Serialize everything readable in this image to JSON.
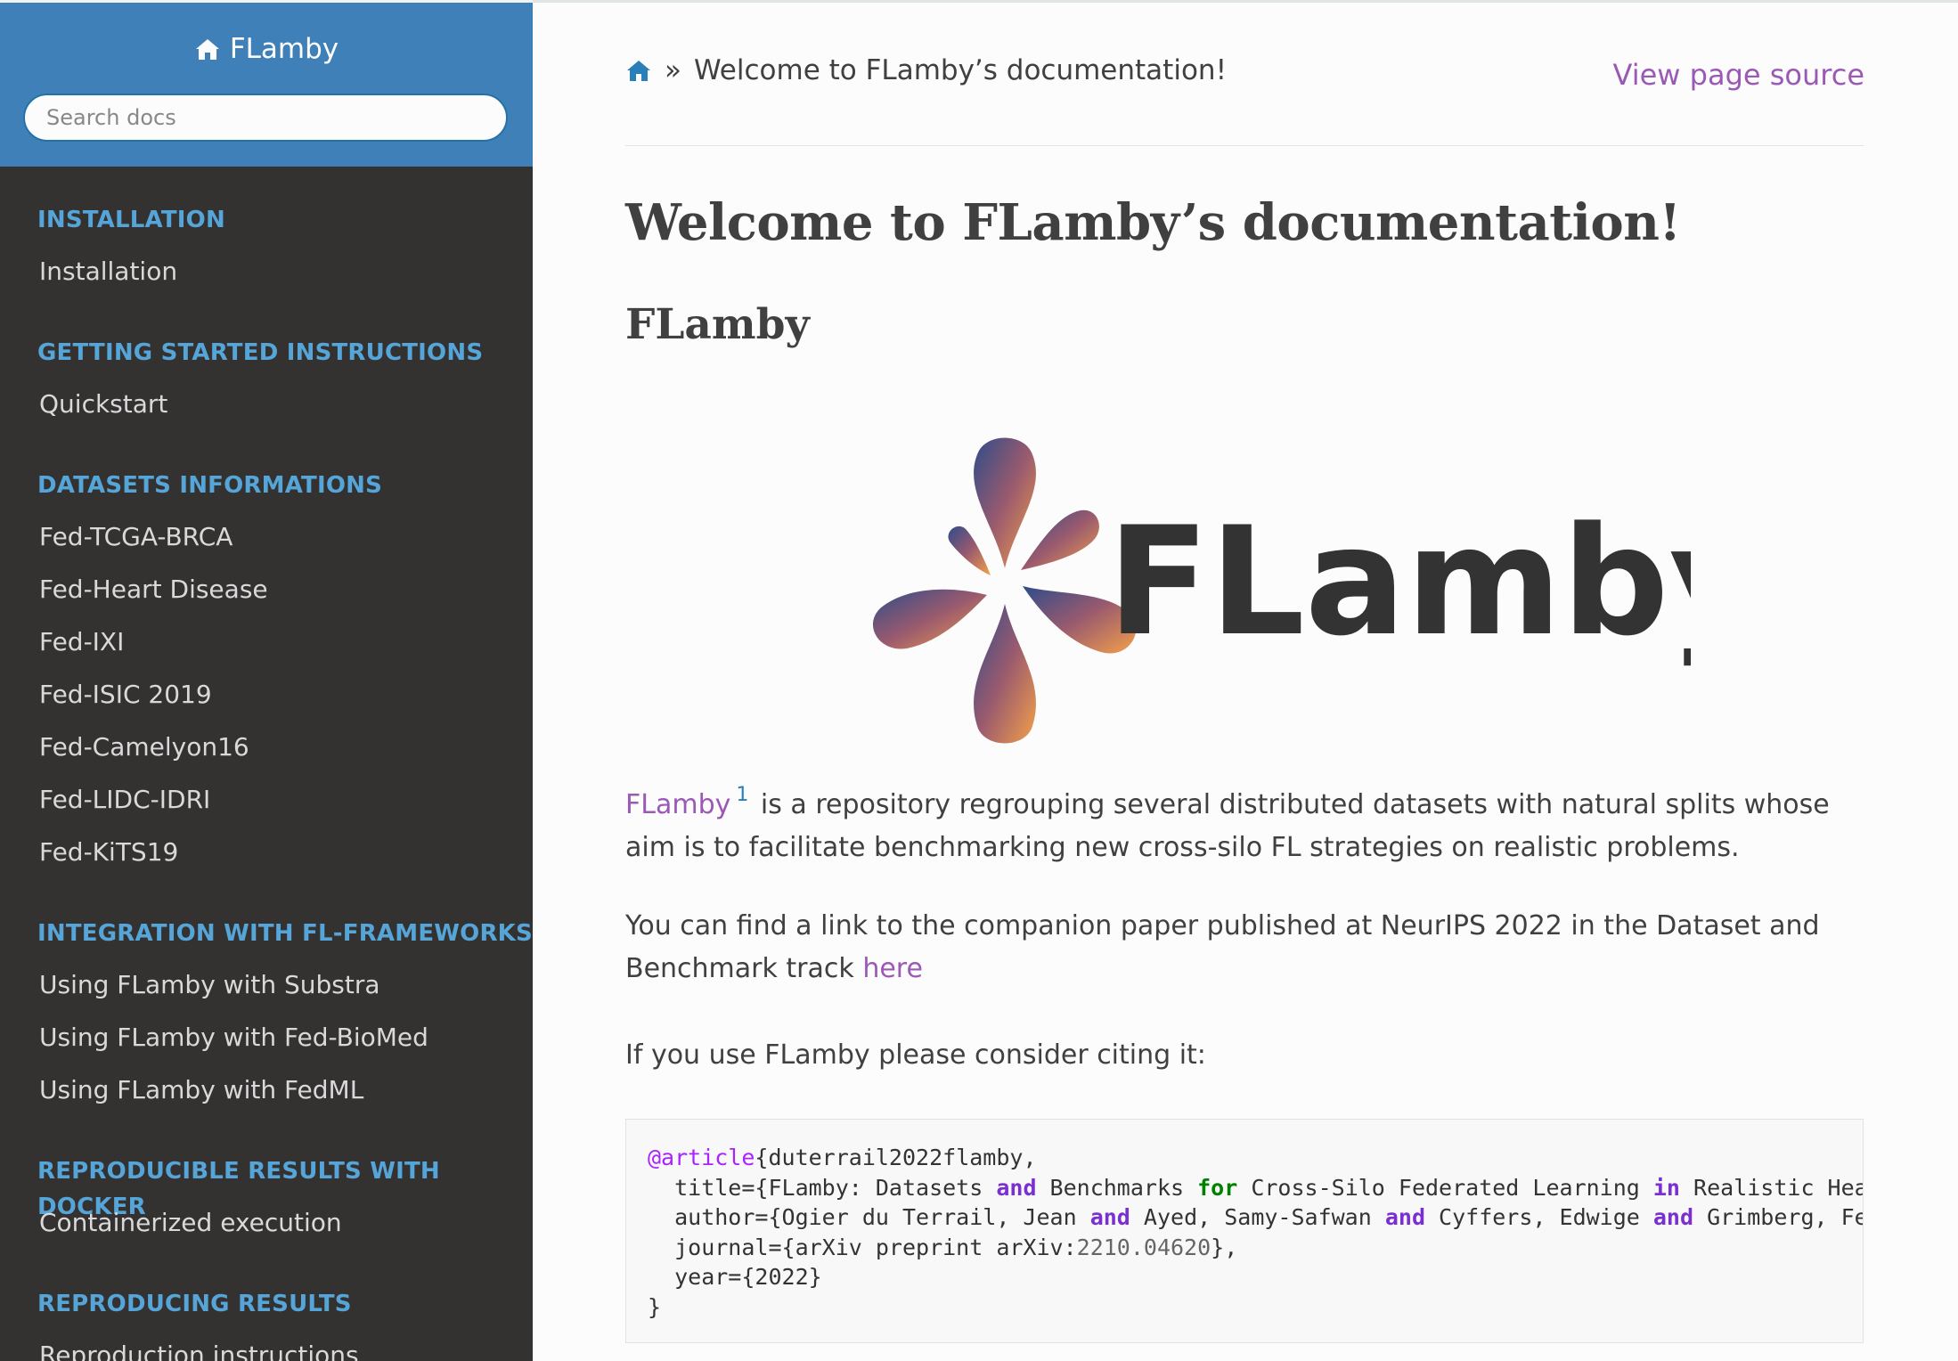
{
  "sidebar": {
    "brand": "FLamby",
    "search_placeholder": "Search docs",
    "sections": [
      {
        "caption": "INSTALLATION",
        "items": [
          "Installation"
        ]
      },
      {
        "caption": "GETTING STARTED INSTRUCTIONS",
        "items": [
          "Quickstart"
        ]
      },
      {
        "caption": "DATASETS INFORMATIONS",
        "items": [
          "Fed-TCGA-BRCA",
          "Fed-Heart Disease",
          "Fed-IXI",
          "Fed-ISIC 2019",
          "Fed-Camelyon16",
          "Fed-LIDC-IDRI",
          "Fed-KiTS19"
        ]
      },
      {
        "caption": "INTEGRATION WITH FL-FRAMEWORKS",
        "items": [
          "Using FLamby with Substra",
          "Using FLamby with Fed-BioMed",
          "Using FLamby with FedML"
        ]
      },
      {
        "caption": "REPRODUCIBLE RESULTS WITH DOCKER",
        "items": [
          "Containerized execution"
        ]
      },
      {
        "caption": "REPRODUCING RESULTS",
        "items": [
          "Reproduction instructions"
        ]
      }
    ]
  },
  "breadcrumb": {
    "separator": "»",
    "current": "Welcome to FLamby’s documentation!"
  },
  "view_source": "View page source",
  "page_title": "Welcome to FLamby’s documentation!",
  "section_title": "FLamby",
  "logo_text": "FLamby",
  "intro": {
    "link": "FLamby",
    "footnote": "1",
    "text": "is a repository regrouping several distributed datasets with natural splits whose aim is to facilitate benchmarking new cross-silo FL strategies on realistic problems."
  },
  "paper": {
    "text": "You can find a link to the companion paper published at NeurIPS 2022 in the Dataset and Benchmark track",
    "link": "here"
  },
  "cite_text": "If you use FLamby please consider citing it:",
  "citation": {
    "line1": {
      "decorator": "@article",
      "rest": "{duterrail2022flamby,"
    },
    "line2": [
      "  title={FLamby: Datasets ",
      "and",
      " Benchmarks ",
      "for",
      " Cross-Silo Federated Learning ",
      "in",
      " Realistic Healthcare"
    ],
    "line3": [
      "  author={Ogier du Terrail, Jean ",
      "and",
      " Ayed, Samy-Safwan ",
      "and",
      " Cyffers, Edwige ",
      "and",
      " Grimberg, Felix"
    ],
    "line4": [
      "  journal={arXiv preprint arXiv:",
      "2210.04620",
      "},"
    ],
    "line5": "  year={2022}",
    "line6": "}"
  },
  "colors": {
    "sidebar_top": "#3f80b9",
    "sidebar_bg": "#343131",
    "caption": "#55a5d9",
    "link": "#9b59b6"
  }
}
